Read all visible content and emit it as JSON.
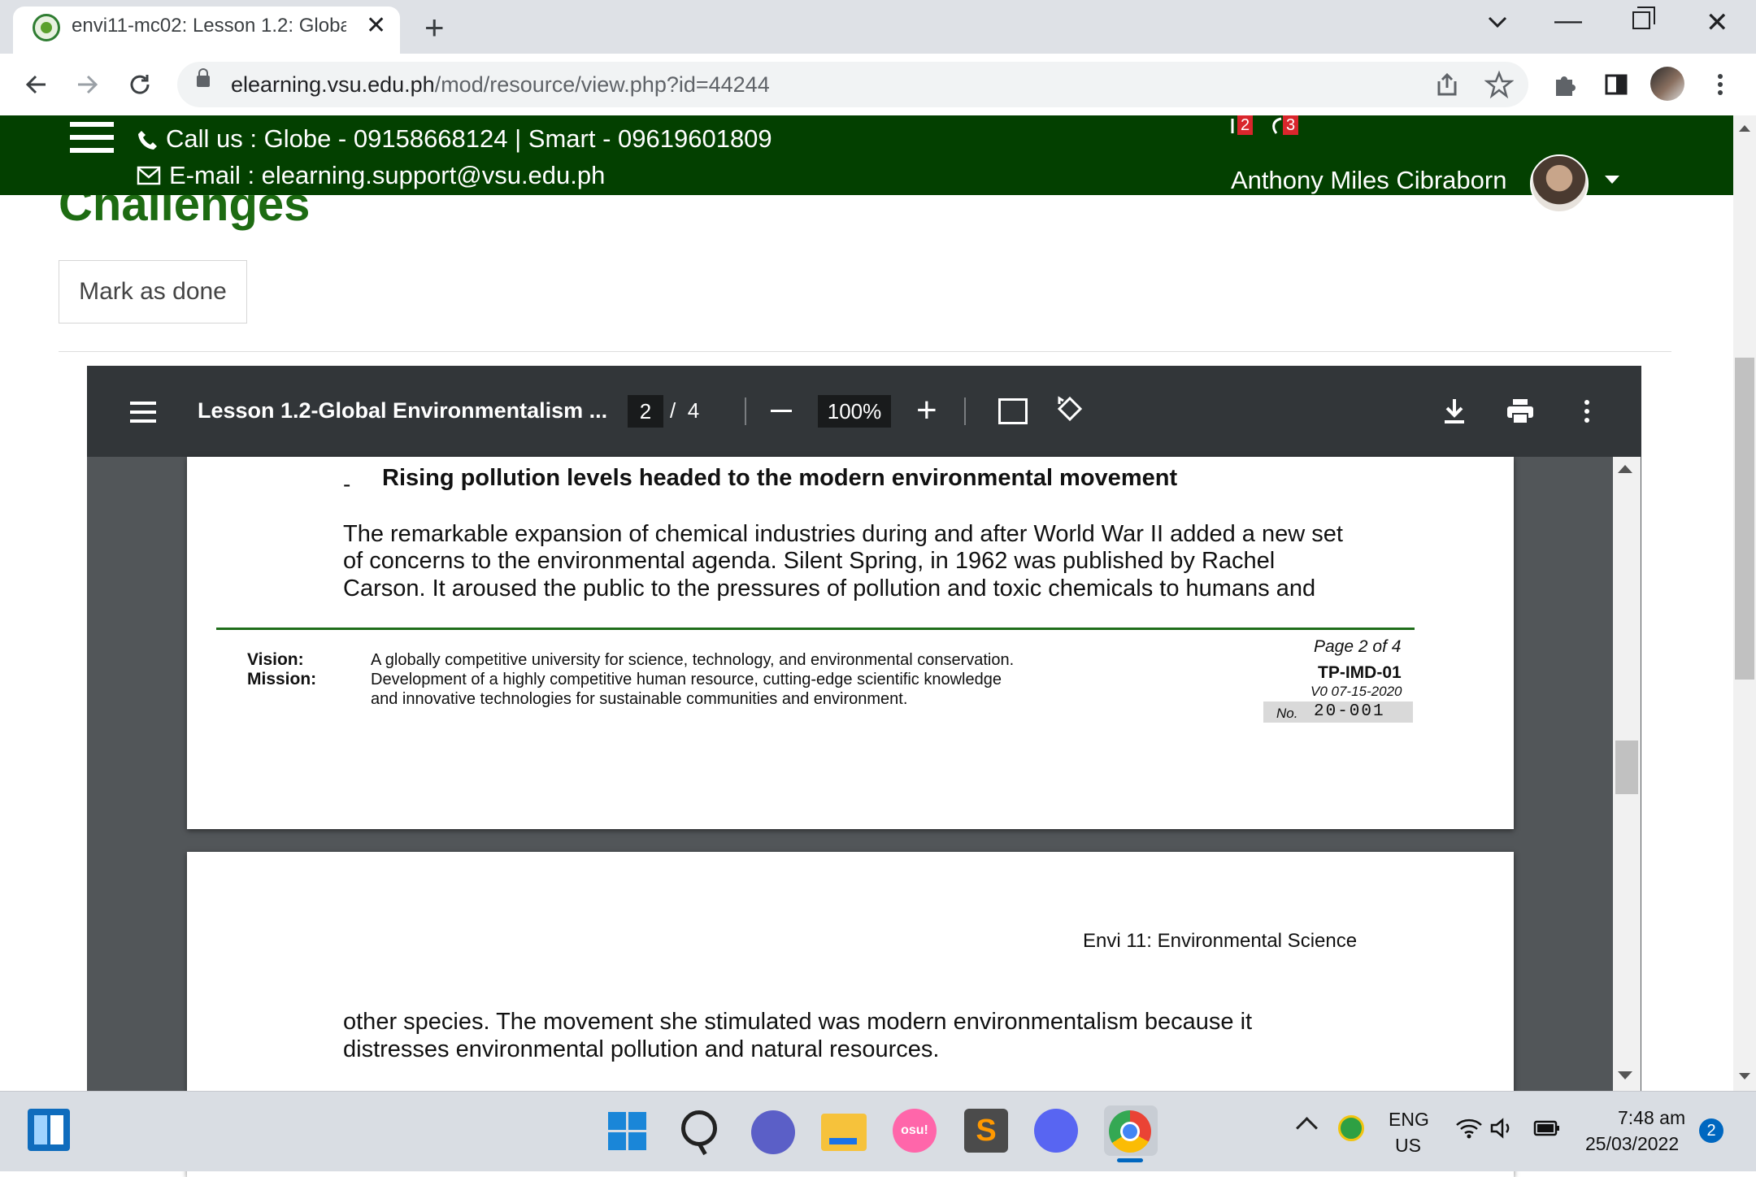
{
  "browser": {
    "tab_title": "envi11-mc02: Lesson 1.2: Global",
    "close_tab_glyph": "✕",
    "new_tab_glyph": "+",
    "url_host": "elearning.vsu.edu.ph",
    "url_path": "/mod/resource/view.php?id=44244",
    "icons": [
      "back-icon",
      "forward-icon",
      "reload-icon",
      "lock-icon",
      "share-icon",
      "star-icon",
      "extensions-icon",
      "side-panel-icon",
      "profile-avatar",
      "kebab-menu-icon"
    ]
  },
  "site_header": {
    "call_text": "Call us : Globe - 09158668124  |  Smart - 09619601809",
    "email_text": "E-mail : elearning.support@vsu.edu.ph",
    "notifications_count": "2",
    "messages_count": "3",
    "user_name": "Anthony Miles Cibraborn",
    "bg_color": "#034000"
  },
  "page": {
    "title_fragment": "Challenges",
    "mark_done_label": "Mark as done"
  },
  "pdf_viewer": {
    "title": "Lesson 1.2-Global Environmentalism ...",
    "current_page": "2",
    "page_separator": "/",
    "total_pages": "4",
    "zoom": "100%",
    "zoom_in_glyph": "+"
  },
  "pdf_page2": {
    "bullet_dash": "-",
    "bullet_heading": "Rising pollution levels headed to the modern environmental movement",
    "paragraph_lines": [
      "The remarkable expansion of chemical industries during and after World War II added a new set",
      "of concerns to the environmental agenda. Silent Spring, in 1962 was published by Rachel",
      "Carson. It aroused the public to the pressures of pollution and toxic chemicals to humans and"
    ],
    "footer": {
      "vision_label": "Vision:",
      "mission_label": "Mission:",
      "vision_text": "A globally competitive university for science, technology, and environmental conservation.",
      "mission_lines": [
        "Development of a highly competitive human resource, cutting-edge scientific knowledge",
        "and innovative technologies for sustainable communities and environment."
      ],
      "page_of": "Page 2 of 4",
      "doc_code": "TP-IMD-01",
      "version": "V0 07-15-2020",
      "no_label": "No.",
      "no_value": "20-001"
    }
  },
  "pdf_page3": {
    "course_header": "Envi 11: Environmental Science",
    "paragraph_lines": [
      "other species. The movement she stimulated was modern environmentalism because it",
      "distresses environmental pollution and natural resources."
    ]
  },
  "taskbar": {
    "apps": [
      "widgets",
      "start",
      "search",
      "teams-chat",
      "file-explorer",
      "osu",
      "sublime-text",
      "discord",
      "chrome"
    ],
    "osu_label": "osu!",
    "sublime_label": "S",
    "lang_line1": "ENG",
    "lang_line2": "US",
    "time": "7:48 am",
    "date": "25/03/2022",
    "notification_count": "2"
  }
}
